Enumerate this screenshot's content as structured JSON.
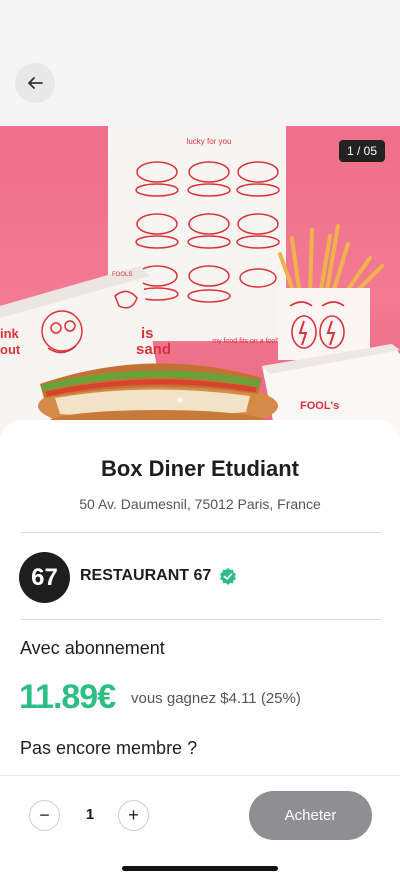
{
  "header": {
    "back_icon": "arrow-left-icon"
  },
  "hero": {
    "counter": "1 / 05",
    "poster_text": "lucky for you",
    "tagline_text": "my food fits on a fool's",
    "box_text": "FOOL's",
    "box_left_text_1": "ink",
    "box_left_text_2": "out",
    "box_right_text_1": "is",
    "box_right_text_2": "sand",
    "brand_small": "FOOLS"
  },
  "product": {
    "title": "Box Diner Etudiant",
    "address": "50 Av. Daumesnil, 75012 Paris, France"
  },
  "restaurant": {
    "logo_text": "67",
    "name": "RESTAURANT 67",
    "verified_icon": "verified-badge-icon",
    "verified_color": "#2ebd85"
  },
  "pricing": {
    "subscription_label": "Avec abonnement",
    "price": "11.89€",
    "savings": "vous gagnez $4.11 (25%)",
    "not_member_label": "Pas encore membre ?",
    "price_color": "#2ebd85"
  },
  "cart": {
    "minus_label": "−",
    "quantity": "1",
    "plus_label": "+",
    "buy_label": "Acheter"
  }
}
